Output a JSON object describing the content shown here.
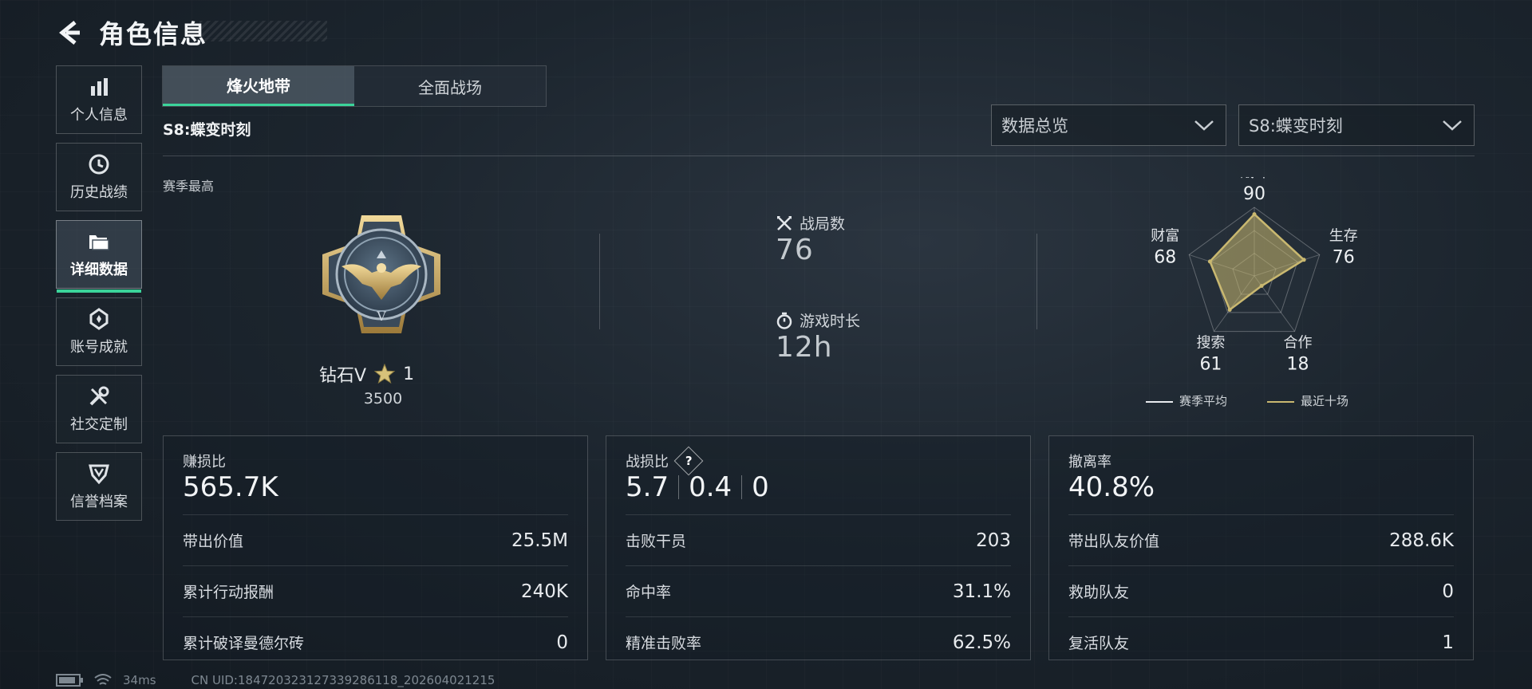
{
  "header": {
    "title": "角色信息",
    "back_icon": "back-arrow-icon"
  },
  "sidebar": {
    "items": [
      {
        "label": "个人信息",
        "icon": "bar-chart-icon",
        "active": false
      },
      {
        "label": "历史战绩",
        "icon": "history-clock-icon",
        "active": false
      },
      {
        "label": "详细数据",
        "icon": "folder-icon",
        "active": true
      },
      {
        "label": "账号成就",
        "icon": "achievement-icon",
        "active": false
      },
      {
        "label": "社交定制",
        "icon": "tools-icon",
        "active": false
      },
      {
        "label": "信誉档案",
        "icon": "shield-icon",
        "active": false
      }
    ]
  },
  "tabs": [
    {
      "label": "烽火地带",
      "active": true
    },
    {
      "label": "全面战场",
      "active": false
    }
  ],
  "season": {
    "name": "S8:蝶变时刻"
  },
  "filters": {
    "view": "数据总览",
    "season": "S8:蝶变时刻"
  },
  "season_best": {
    "label": "赛季最高",
    "rank": "钻石V",
    "stars": "1",
    "points": "3500"
  },
  "overview": {
    "matches_label": "战局数",
    "matches_value": "76",
    "playtime_label": "游戏时长",
    "playtime_value": "12h"
  },
  "radar": {
    "axes": [
      {
        "label": "战斗",
        "value": "90"
      },
      {
        "label": "生存",
        "value": "76"
      },
      {
        "label": "合作",
        "value": "18"
      },
      {
        "label": "搜索",
        "value": "61"
      },
      {
        "label": "财富",
        "value": "68"
      }
    ],
    "values": [
      90,
      76,
      18,
      61,
      68
    ],
    "max": 100,
    "legend": [
      {
        "label": "赛季平均",
        "color": "#e8ebee"
      },
      {
        "label": "最近十场",
        "color": "#c9b870"
      }
    ]
  },
  "cards": {
    "profit": {
      "title": "赚损比",
      "main": "565.7K",
      "rows": [
        {
          "label": "带出价值",
          "value": "25.5M"
        },
        {
          "label": "累计行动报酬",
          "value": "240K"
        },
        {
          "label": "累计破译曼德尔砖",
          "value": "0"
        }
      ]
    },
    "kd": {
      "title": "战损比",
      "help": "?",
      "main": [
        "5.7",
        "0.4",
        "0"
      ],
      "rows": [
        {
          "label": "击败干员",
          "value": "203"
        },
        {
          "label": "命中率",
          "value": "31.1%"
        },
        {
          "label": "精准击败率",
          "value": "62.5%"
        }
      ]
    },
    "extract": {
      "title": "撤离率",
      "main": "40.8%",
      "rows": [
        {
          "label": "带出队友价值",
          "value": "288.6K"
        },
        {
          "label": "救助队友",
          "value": "0"
        },
        {
          "label": "复活队友",
          "value": "1"
        }
      ]
    }
  },
  "footer": {
    "ping": "34ms",
    "uid": "CN UID:1847203231273392​86118_202604021215"
  },
  "colors": {
    "accent": "#3bd39a",
    "gold": "#c9b870"
  }
}
